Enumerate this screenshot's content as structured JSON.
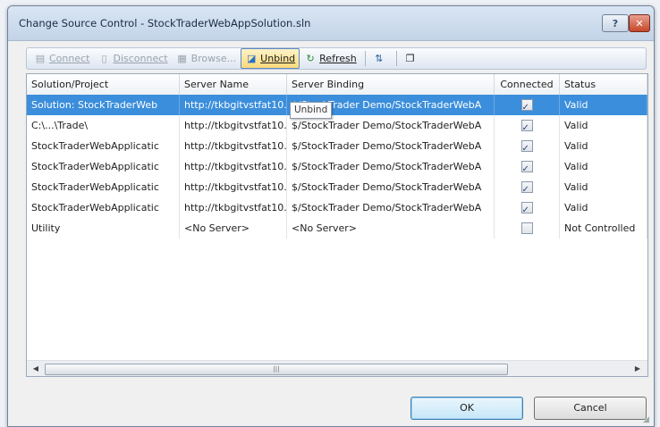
{
  "window": {
    "title": "Change Source Control - StockTraderWebAppSolution.sln"
  },
  "titlebar": {
    "help_label": "?",
    "close_label": "✕"
  },
  "toolbar": {
    "connect": "Connect",
    "disconnect": "Disconnect",
    "browse": "Browse...",
    "unbind": "Unbind",
    "refresh": "Refresh"
  },
  "columns": [
    "Solution/Project",
    "Server Name",
    "Server Binding",
    "Connected",
    "Status"
  ],
  "rows": [
    {
      "project": "Solution: StockTraderWeb",
      "server": "http://tkbgitvstfat10.",
      "binding": "$/StockTrader Demo/StockTraderWebA",
      "connected": true,
      "status": "Valid"
    },
    {
      "project": "C:\\...\\Trade\\",
      "server": "http://tkbgitvstfat10.",
      "binding": "$/StockTrader Demo/StockTraderWebA",
      "connected": true,
      "status": "Valid"
    },
    {
      "project": "StockTraderWebApplicatic",
      "server": "http://tkbgitvstfat10.",
      "binding": "$/StockTrader Demo/StockTraderWebA",
      "connected": true,
      "status": "Valid"
    },
    {
      "project": "StockTraderWebApplicatic",
      "server": "http://tkbgitvstfat10.",
      "binding": "$/StockTrader Demo/StockTraderWebA",
      "connected": true,
      "status": "Valid"
    },
    {
      "project": "StockTraderWebApplicatic",
      "server": "http://tkbgitvstfat10.",
      "binding": "$/StockTrader Demo/StockTraderWebA",
      "connected": true,
      "status": "Valid"
    },
    {
      "project": "StockTraderWebApplicatic",
      "server": "http://tkbgitvstfat10.",
      "binding": "$/StockTrader Demo/StockTraderWebA",
      "connected": true,
      "status": "Valid"
    },
    {
      "project": "Utility",
      "server": "<No Server>",
      "binding": "<No Server>",
      "connected": false,
      "status": "Not Controlled"
    }
  ],
  "tooltip": "Unbind",
  "scrollbar": {
    "thumb_grip": "|||"
  },
  "buttons": {
    "ok": "OK",
    "cancel": "Cancel"
  },
  "colors": {
    "selection": "#3b8edb",
    "title_bar": "#c3d4e8",
    "close_button": "#c6472b"
  },
  "icons": [
    "connect-icon",
    "disconnect-icon",
    "browse-icon",
    "unbind-icon",
    "refresh-icon",
    "sort-icon",
    "properties-icon"
  ]
}
